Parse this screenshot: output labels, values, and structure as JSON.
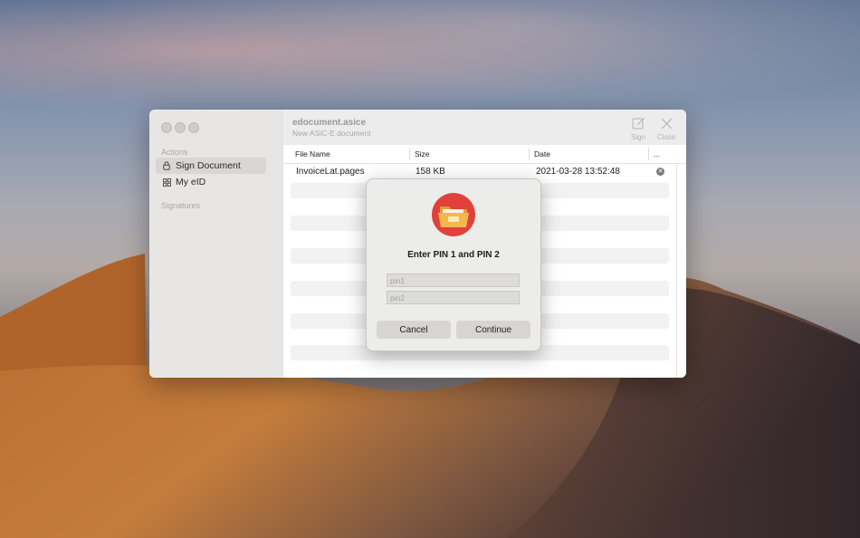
{
  "window": {
    "title": "edocument.asice",
    "subtitle": "New ASiC-E document",
    "toolbar": {
      "sign_label": "Sign",
      "close_label": "Close"
    }
  },
  "sidebar": {
    "actions_header": "Actions",
    "items": [
      {
        "label": "Sign Document",
        "icon": "lock-icon",
        "active": true
      },
      {
        "label": "My eID",
        "icon": "grid-icon",
        "active": false
      }
    ],
    "signatures_header": "Signatures"
  },
  "table": {
    "columns": [
      "File Name",
      "Size",
      "Date",
      "..."
    ],
    "rows": [
      {
        "file_name": "InvoiceLat.pages",
        "size": "158 KB",
        "date": "2021-03-28 13:52:48"
      }
    ]
  },
  "dialog": {
    "title": "Enter PIN 1 and PIN 2",
    "pin1_placeholder": "pin1",
    "pin2_placeholder": "pin2",
    "cancel_label": "Cancel",
    "continue_label": "Continue",
    "icon": "folder-icon"
  },
  "colors": {
    "icon_red": "#e0413a",
    "icon_folder": "#f2b84b",
    "sidebar_bg": "#e8e6e5",
    "dialog_bg": "#ececeb"
  }
}
